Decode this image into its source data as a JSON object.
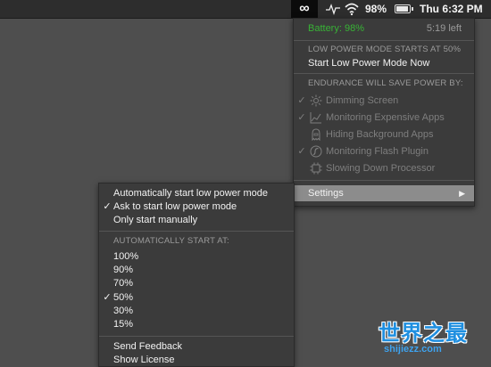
{
  "menubar": {
    "app_icon": "infinity-icon",
    "battery_percent": "98%",
    "clock": "Thu 6:32 PM"
  },
  "main_menu": {
    "battery_label": "Battery: 98%",
    "time_left": "5:19 left",
    "low_power_header": "LOW POWER MODE STARTS AT 50%",
    "start_low_power": "Start Low Power Mode Now",
    "endurance_header": "ENDURANCE WILL SAVE POWER BY:",
    "features": [
      {
        "label": "Dimming Screen",
        "checked": true,
        "icon": "sun-icon"
      },
      {
        "label": "Monitoring Expensive Apps",
        "checked": true,
        "icon": "chart-icon"
      },
      {
        "label": "Hiding Background Apps",
        "checked": false,
        "icon": "ghost-icon"
      },
      {
        "label": "Monitoring Flash Plugin",
        "checked": true,
        "icon": "flash-icon"
      },
      {
        "label": "Slowing Down Processor",
        "checked": false,
        "icon": "chip-icon"
      }
    ],
    "settings": "Settings",
    "accent_green": "#38b236"
  },
  "sub_menu": {
    "mode_options": [
      {
        "label": "Automatically start low power mode",
        "checked": false
      },
      {
        "label": "Ask to start low power mode",
        "checked": true
      },
      {
        "label": "Only start manually",
        "checked": false
      }
    ],
    "auto_header": "AUTOMATICALLY START AT:",
    "thresholds": [
      {
        "label": "100%",
        "checked": false
      },
      {
        "label": "90%",
        "checked": false
      },
      {
        "label": "70%",
        "checked": false
      },
      {
        "label": "50%",
        "checked": true
      },
      {
        "label": "30%",
        "checked": false
      },
      {
        "label": "15%",
        "checked": false
      }
    ],
    "send_feedback": "Send Feedback",
    "show_license": "Show License"
  },
  "watermark": {
    "title": "世界之最",
    "url": "shijiezz.com"
  }
}
